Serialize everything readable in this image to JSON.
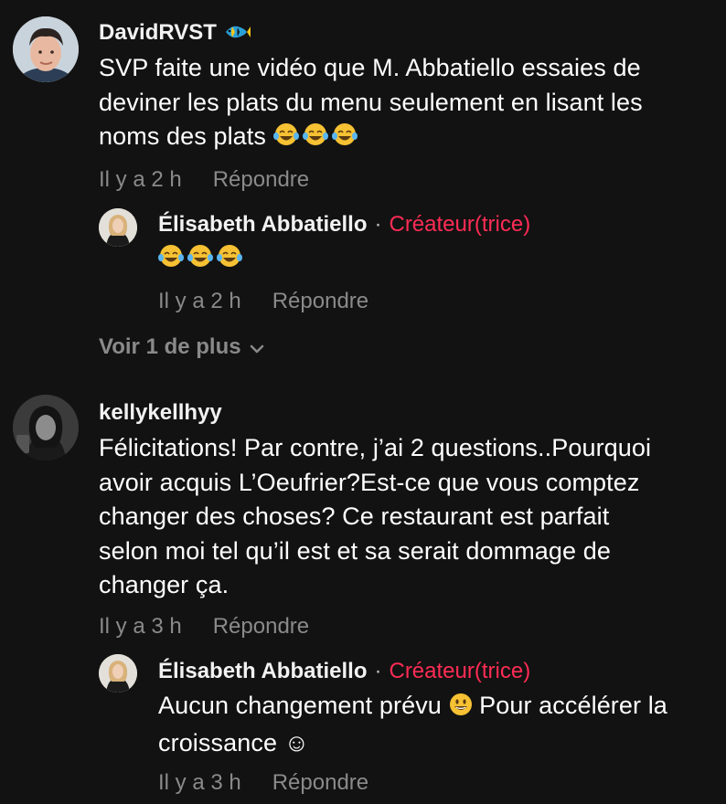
{
  "comments": [
    {
      "username": "DavidRVST",
      "username_emoji": "fish-icon",
      "lines": [
        "SVP faite une vidéo que M. Abbatiello essaies de",
        "deviner les plats du menu seulement en lisant les",
        "noms des plats"
      ],
      "time": "Il y a 2 h",
      "reply_label": "Répondre",
      "reply": {
        "username": "Élisabeth Abbatiello",
        "separator": "·",
        "creator_label": "Créateur(trice)",
        "text": "",
        "time": "Il y a 2 h",
        "reply_label": "Répondre"
      },
      "view_more": "Voir 1 de plus"
    },
    {
      "username": "kellykellhyy",
      "lines": [
        "Félicitations! Par contre, j’ai 2 questions..Pourquoi",
        "avoir acquis L’Oeufrier?Est-ce que vous comptez",
        "changer des choses? Ce restaurant est parfait",
        "selon moi tel qu’il est et sa serait dommage de",
        "changer ça."
      ],
      "time": "Il y a 3 h",
      "reply_label": "Répondre",
      "reply": {
        "username": "Élisabeth Abbatiello",
        "separator": "·",
        "creator_label": "Créateur(trice)",
        "line1_a": "Aucun changement prévu",
        "line1_b": "Pour accélérer la",
        "line2": "croissance ☺",
        "time": "Il y a 3 h",
        "reply_label": "Répondre"
      }
    }
  ],
  "colors": {
    "background": "#121212",
    "creator": "#fe2c55",
    "muted": "#8a8a8a"
  }
}
